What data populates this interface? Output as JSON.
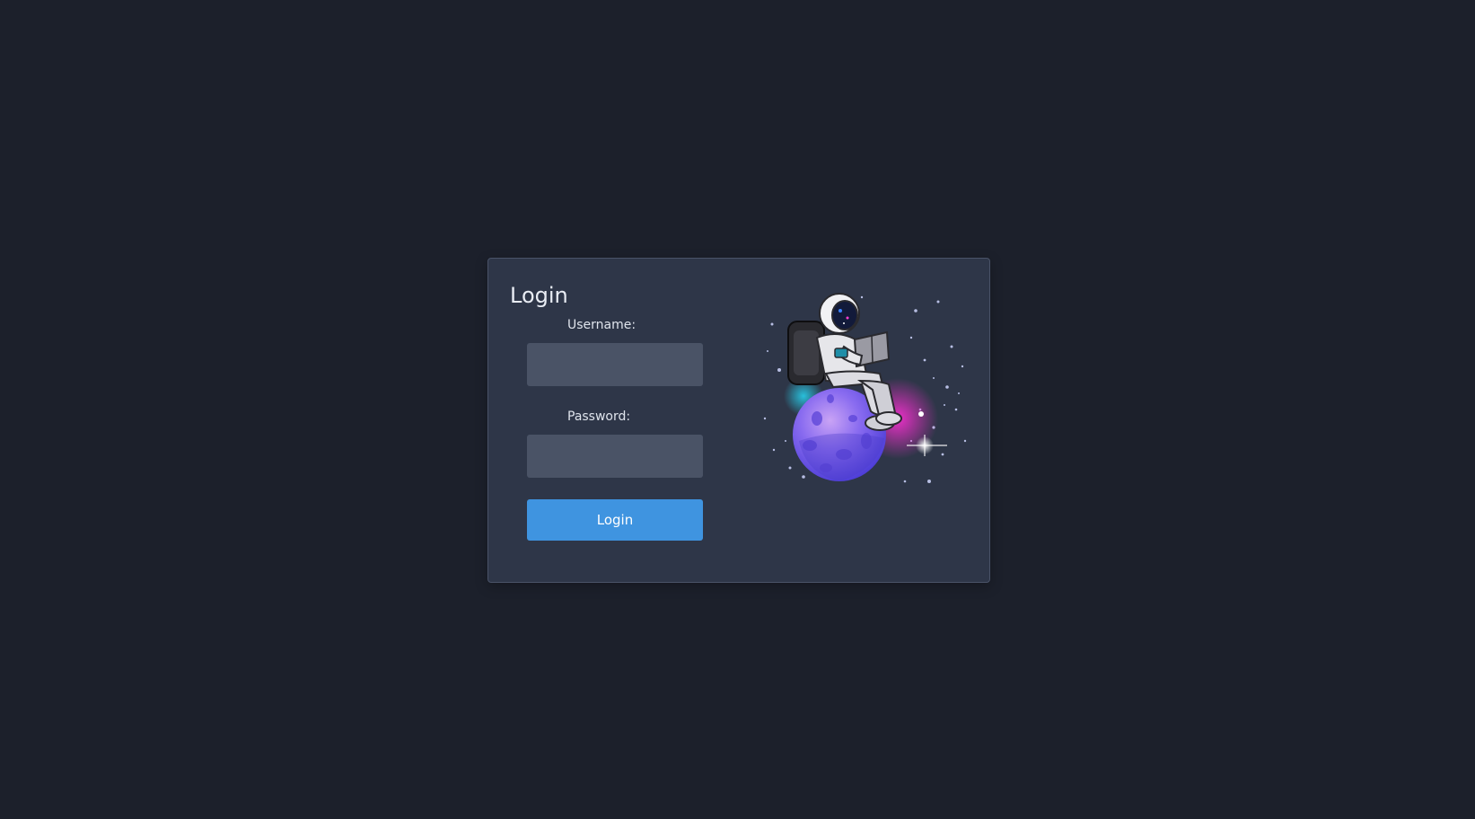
{
  "login": {
    "title": "Login",
    "username_label": "Username:",
    "username_value": "",
    "password_label": "Password:",
    "password_value": "",
    "submit_label": "Login"
  },
  "theme": {
    "background": "#1c202b",
    "card": "#2e3648",
    "input": "#4a5366",
    "accent": "#3f94e0"
  },
  "illustration": {
    "icon": "astronaut-on-planet-illustration"
  }
}
